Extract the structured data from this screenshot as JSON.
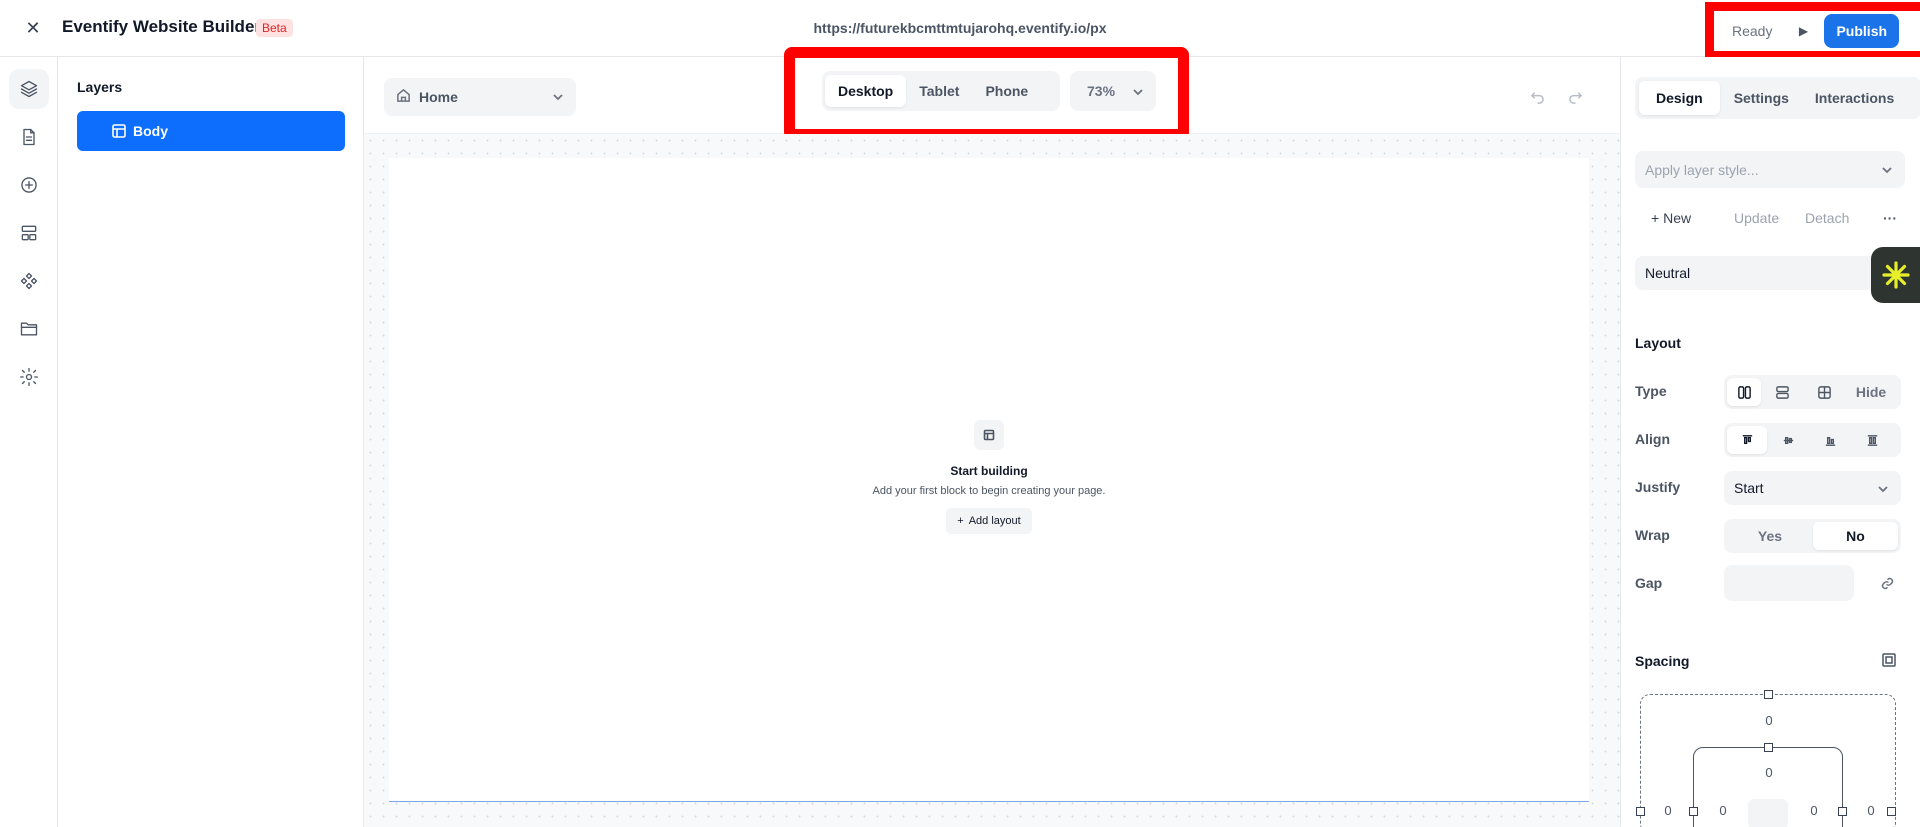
{
  "topbar": {
    "app_title": "Eventify Website Builder",
    "beta_badge": "Beta",
    "url": "https://futurekbcmttmtujarohq.eventify.io/px",
    "status": "Ready",
    "publish_label": "Publish"
  },
  "rail": {
    "icons": [
      "layers-icon",
      "pages-icon",
      "add-icon",
      "sections-icon",
      "components-icon",
      "folder-icon",
      "settings-icon"
    ]
  },
  "layers": {
    "title": "Layers",
    "items": [
      {
        "label": "Body"
      }
    ]
  },
  "canvas": {
    "page_select": "Home",
    "devices": [
      "Desktop",
      "Tablet",
      "Phone"
    ],
    "active_device": "Desktop",
    "zoom": "73%",
    "empty_title": "Start building",
    "empty_sub": "Add your first block to begin creating your page.",
    "add_layout_label": "Add layout"
  },
  "inspector": {
    "tabs": [
      "Design",
      "Settings",
      "Interactions"
    ],
    "active_tab": "Design",
    "layer_style_placeholder": "Apply layer style...",
    "style_actions": {
      "new": "New",
      "update": "Update",
      "detach": "Detach",
      "more": "···"
    },
    "neutral": "Neutral",
    "layout_title": "Layout",
    "type_label": "Type",
    "type_hide": "Hide",
    "align_label": "Align",
    "justify_label": "Justify",
    "justify_value": "Start",
    "wrap_label": "Wrap",
    "wrap_yes": "Yes",
    "wrap_no": "No",
    "gap_label": "Gap",
    "spacing_title": "Spacing",
    "spacing_values": {
      "margin_top": "0",
      "padding_top": "0",
      "margin_left": "0",
      "padding_left": "0",
      "padding_right": "0",
      "margin_right": "0"
    }
  },
  "colors": {
    "accent": "#1a73e8",
    "layer_active": "#0d6efd",
    "highlight_frame": "#ff0000"
  }
}
